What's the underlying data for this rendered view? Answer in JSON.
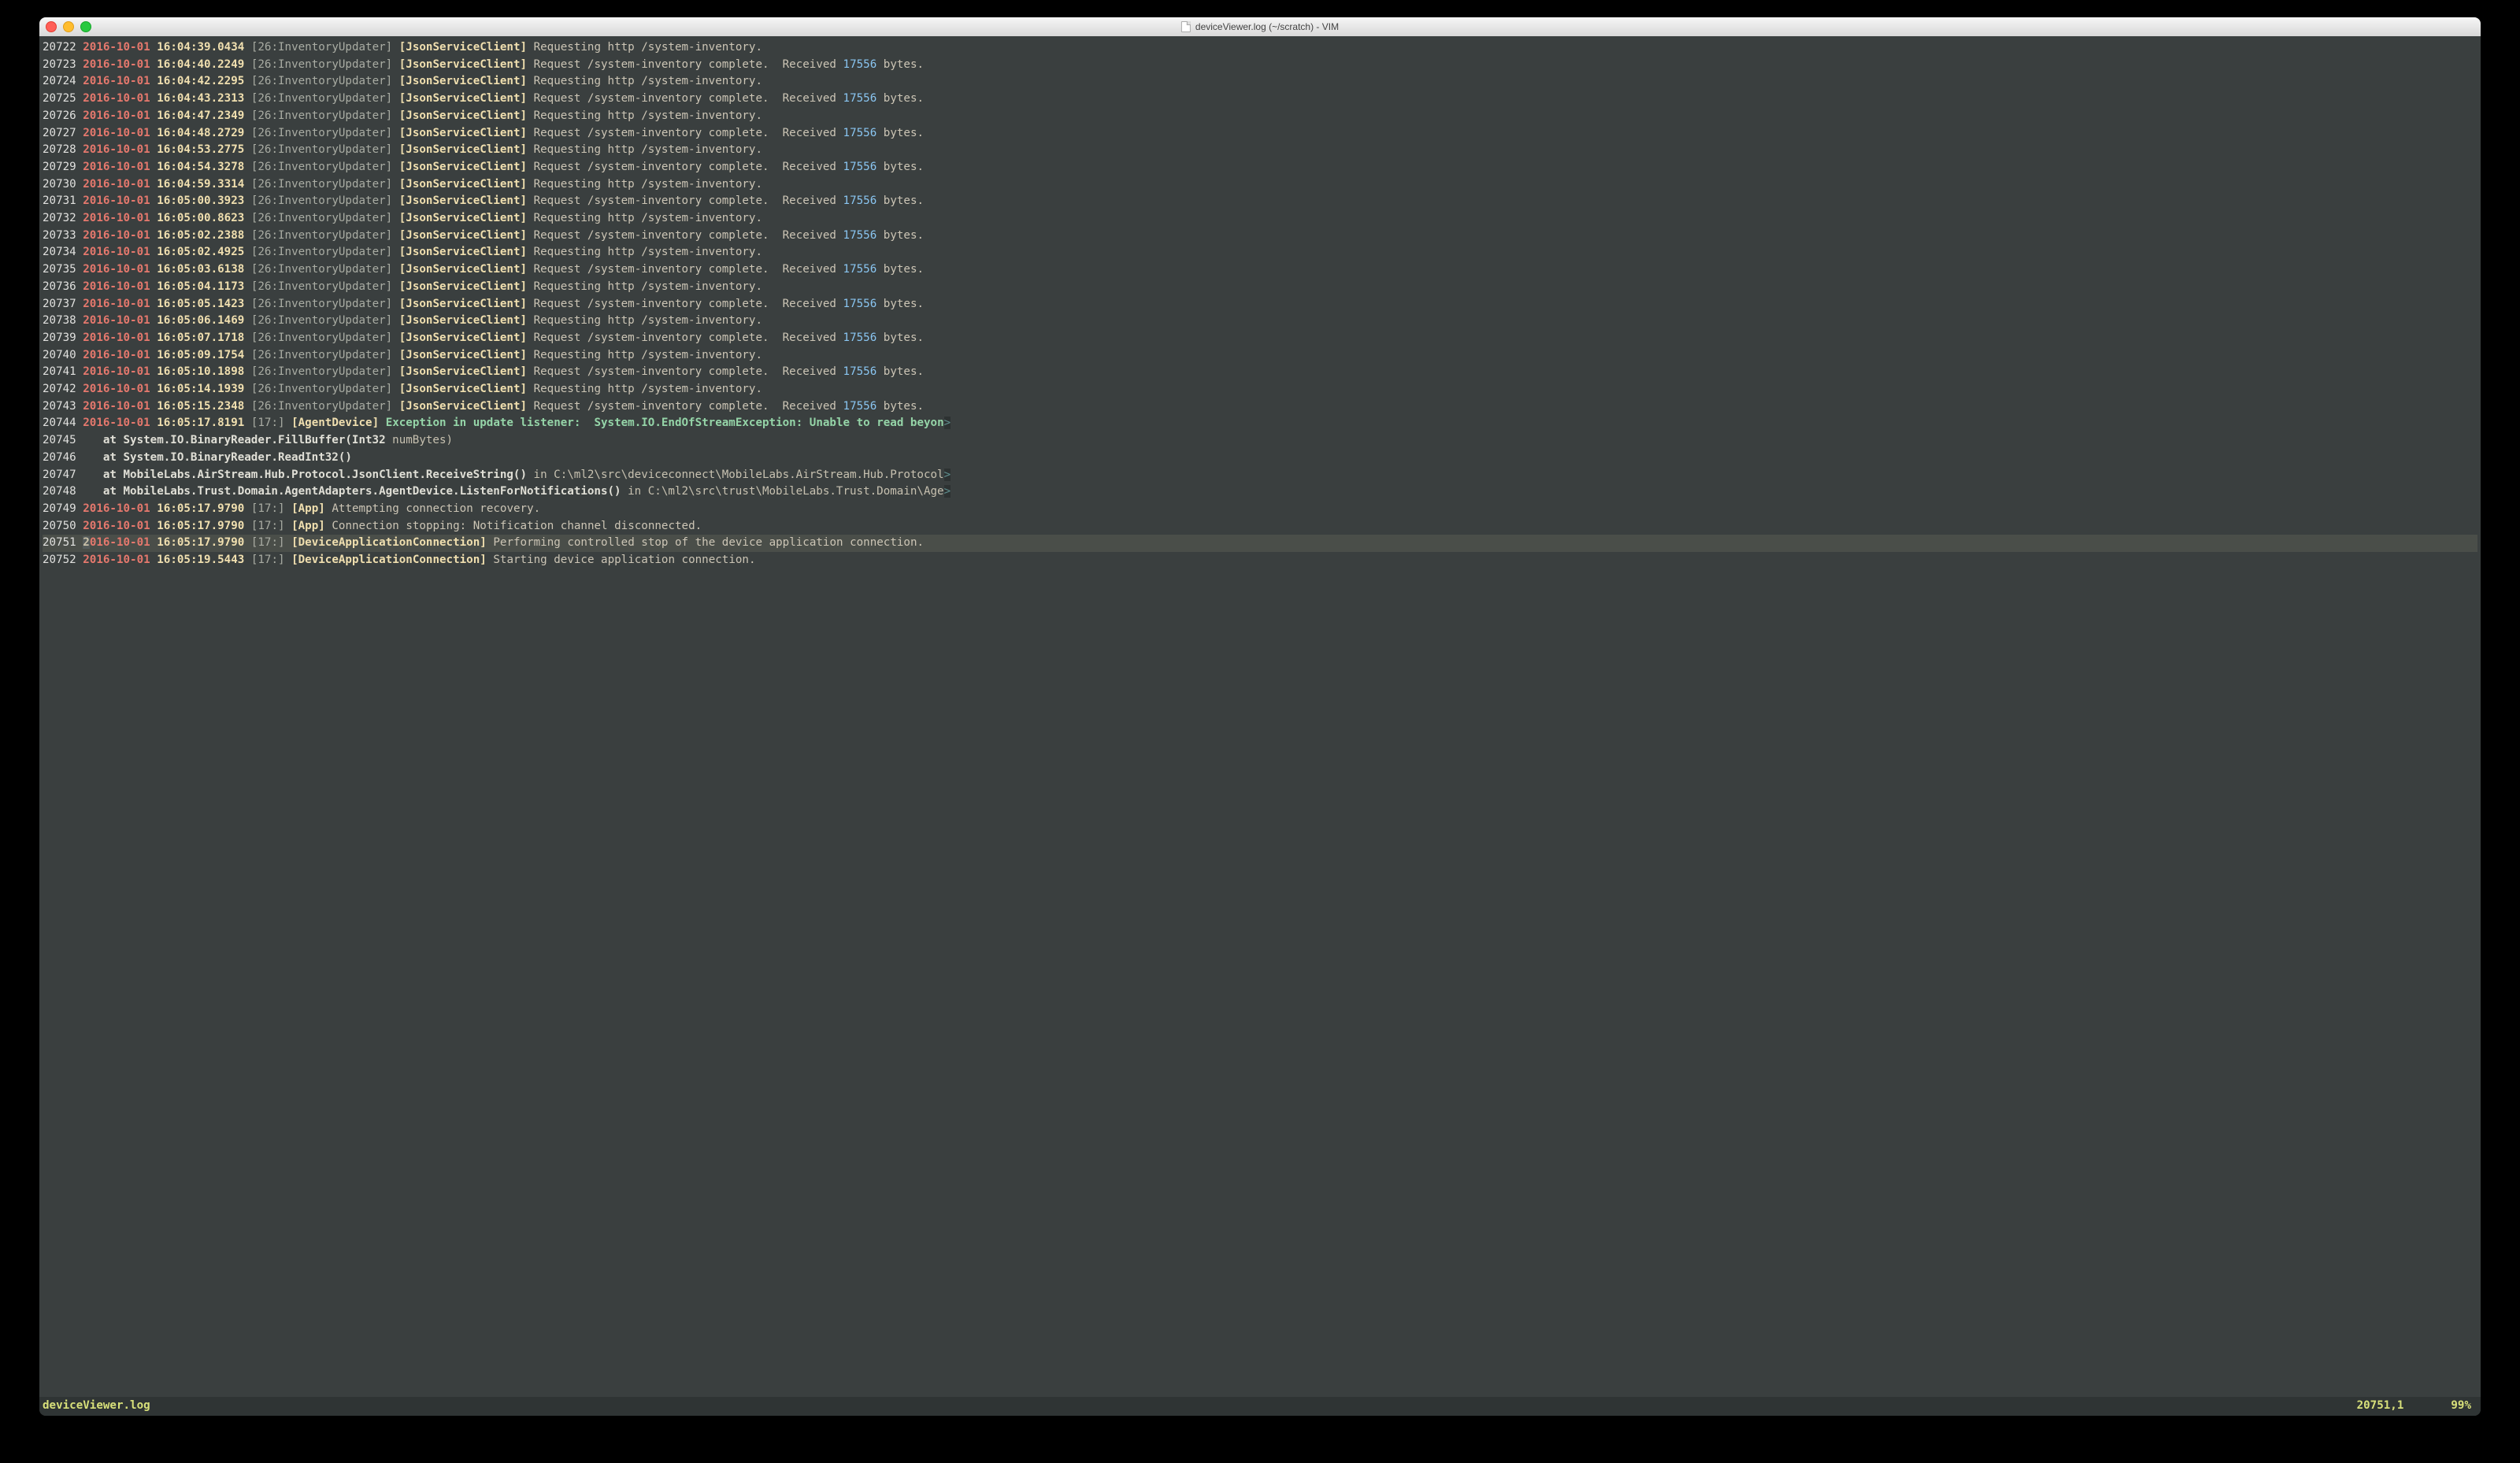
{
  "window": {
    "title": "deviceViewer.log (~/scratch) - VIM"
  },
  "status": {
    "filename": "deviceViewer.log",
    "position": "20751,1",
    "percent": "99%"
  },
  "cursor_row_index": 29,
  "lines": [
    {
      "n": "20722",
      "d": "2016-10-01",
      "t": "16:04:39.0434",
      "thr": "[26:InventoryUpdater]",
      "svc": "[JsonServiceClient]",
      "m1": "Requesting http /system-inventory.",
      "rx": null
    },
    {
      "n": "20723",
      "d": "2016-10-01",
      "t": "16:04:40.2249",
      "thr": "[26:InventoryUpdater]",
      "svc": "[JsonServiceClient]",
      "m1": "Request /system-inventory complete.",
      "rx": "17556"
    },
    {
      "n": "20724",
      "d": "2016-10-01",
      "t": "16:04:42.2295",
      "thr": "[26:InventoryUpdater]",
      "svc": "[JsonServiceClient]",
      "m1": "Requesting http /system-inventory.",
      "rx": null
    },
    {
      "n": "20725",
      "d": "2016-10-01",
      "t": "16:04:43.2313",
      "thr": "[26:InventoryUpdater]",
      "svc": "[JsonServiceClient]",
      "m1": "Request /system-inventory complete.",
      "rx": "17556"
    },
    {
      "n": "20726",
      "d": "2016-10-01",
      "t": "16:04:47.2349",
      "thr": "[26:InventoryUpdater]",
      "svc": "[JsonServiceClient]",
      "m1": "Requesting http /system-inventory.",
      "rx": null
    },
    {
      "n": "20727",
      "d": "2016-10-01",
      "t": "16:04:48.2729",
      "thr": "[26:InventoryUpdater]",
      "svc": "[JsonServiceClient]",
      "m1": "Request /system-inventory complete.",
      "rx": "17556"
    },
    {
      "n": "20728",
      "d": "2016-10-01",
      "t": "16:04:53.2775",
      "thr": "[26:InventoryUpdater]",
      "svc": "[JsonServiceClient]",
      "m1": "Requesting http /system-inventory.",
      "rx": null
    },
    {
      "n": "20729",
      "d": "2016-10-01",
      "t": "16:04:54.3278",
      "thr": "[26:InventoryUpdater]",
      "svc": "[JsonServiceClient]",
      "m1": "Request /system-inventory complete.",
      "rx": "17556"
    },
    {
      "n": "20730",
      "d": "2016-10-01",
      "t": "16:04:59.3314",
      "thr": "[26:InventoryUpdater]",
      "svc": "[JsonServiceClient]",
      "m1": "Requesting http /system-inventory.",
      "rx": null
    },
    {
      "n": "20731",
      "d": "2016-10-01",
      "t": "16:05:00.3923",
      "thr": "[26:InventoryUpdater]",
      "svc": "[JsonServiceClient]",
      "m1": "Request /system-inventory complete.",
      "rx": "17556"
    },
    {
      "n": "20732",
      "d": "2016-10-01",
      "t": "16:05:00.8623",
      "thr": "[26:InventoryUpdater]",
      "svc": "[JsonServiceClient]",
      "m1": "Requesting http /system-inventory.",
      "rx": null
    },
    {
      "n": "20733",
      "d": "2016-10-01",
      "t": "16:05:02.2388",
      "thr": "[26:InventoryUpdater]",
      "svc": "[JsonServiceClient]",
      "m1": "Request /system-inventory complete.",
      "rx": "17556"
    },
    {
      "n": "20734",
      "d": "2016-10-01",
      "t": "16:05:02.4925",
      "thr": "[26:InventoryUpdater]",
      "svc": "[JsonServiceClient]",
      "m1": "Requesting http /system-inventory.",
      "rx": null
    },
    {
      "n": "20735",
      "d": "2016-10-01",
      "t": "16:05:03.6138",
      "thr": "[26:InventoryUpdater]",
      "svc": "[JsonServiceClient]",
      "m1": "Request /system-inventory complete.",
      "rx": "17556"
    },
    {
      "n": "20736",
      "d": "2016-10-01",
      "t": "16:05:04.1173",
      "thr": "[26:InventoryUpdater]",
      "svc": "[JsonServiceClient]",
      "m1": "Requesting http /system-inventory.",
      "rx": null
    },
    {
      "n": "20737",
      "d": "2016-10-01",
      "t": "16:05:05.1423",
      "thr": "[26:InventoryUpdater]",
      "svc": "[JsonServiceClient]",
      "m1": "Request /system-inventory complete.",
      "rx": "17556"
    },
    {
      "n": "20738",
      "d": "2016-10-01",
      "t": "16:05:06.1469",
      "thr": "[26:InventoryUpdater]",
      "svc": "[JsonServiceClient]",
      "m1": "Requesting http /system-inventory.",
      "rx": null
    },
    {
      "n": "20739",
      "d": "2016-10-01",
      "t": "16:05:07.1718",
      "thr": "[26:InventoryUpdater]",
      "svc": "[JsonServiceClient]",
      "m1": "Request /system-inventory complete.",
      "rx": "17556"
    },
    {
      "n": "20740",
      "d": "2016-10-01",
      "t": "16:05:09.1754",
      "thr": "[26:InventoryUpdater]",
      "svc": "[JsonServiceClient]",
      "m1": "Requesting http /system-inventory.",
      "rx": null
    },
    {
      "n": "20741",
      "d": "2016-10-01",
      "t": "16:05:10.1898",
      "thr": "[26:InventoryUpdater]",
      "svc": "[JsonServiceClient]",
      "m1": "Request /system-inventory complete.",
      "rx": "17556"
    },
    {
      "n": "20742",
      "d": "2016-10-01",
      "t": "16:05:14.1939",
      "thr": "[26:InventoryUpdater]",
      "svc": "[JsonServiceClient]",
      "m1": "Requesting http /system-inventory.",
      "rx": null
    },
    {
      "n": "20743",
      "d": "2016-10-01",
      "t": "16:05:15.2348",
      "thr": "[26:InventoryUpdater]",
      "svc": "[JsonServiceClient]",
      "m1": "Request /system-inventory complete.",
      "rx": "17556"
    },
    {
      "kind": "exc",
      "n": "20744",
      "d": "2016-10-01",
      "t": "16:05:17.8191",
      "thr": "[17:]",
      "svc": "[AgentDevice]",
      "m1": "Exception in update listener:  System.IO.EndOfStreamException: Unable to read beyon",
      "ext": ">"
    },
    {
      "kind": "trace",
      "n": "20745",
      "lead": "   at ",
      "bold": "System.IO.BinaryReader.FillBuffer(Int32",
      "tail": " numBytes)"
    },
    {
      "kind": "trace",
      "n": "20746",
      "lead": "   at ",
      "bold": "System.IO.BinaryReader.ReadInt32()",
      "tail": ""
    },
    {
      "kind": "trace",
      "n": "20747",
      "lead": "   at ",
      "bold": "MobileLabs.AirStream.Hub.Protocol.JsonClient.ReceiveString()",
      "tail": " in C:\\ml2\\src\\deviceconnect\\MobileLabs.AirStream.Hub.Protocol",
      "ext": ">"
    },
    {
      "kind": "trace",
      "n": "20748",
      "lead": "   at ",
      "bold": "MobileLabs.Trust.Domain.AgentAdapters.AgentDevice.ListenForNotifications()",
      "tail": " in C:\\ml2\\src\\trust\\MobileLabs.Trust.Domain\\Age",
      "ext": ">"
    },
    {
      "n": "20749",
      "d": "2016-10-01",
      "t": "16:05:17.9790",
      "thr": "[17:]",
      "svc": "[App]",
      "m1": "Attempting connection recovery.",
      "rx": null
    },
    {
      "n": "20750",
      "d": "2016-10-01",
      "t": "16:05:17.9790",
      "thr": "[17:]",
      "svc": "[App]",
      "m1": "Connection stopping: Notification channel disconnected.",
      "rx": null
    },
    {
      "n": "20751",
      "d": "2016-10-01",
      "t": "16:05:17.9790",
      "thr": "[17:]",
      "svc": "[DeviceApplicationConnection]",
      "m1": "Performing controlled stop of the device application connection.",
      "rx": null,
      "cursor": true
    },
    {
      "n": "20752",
      "d": "2016-10-01",
      "t": "16:05:19.5443",
      "thr": "[17:]",
      "svc": "[DeviceApplicationConnection]",
      "m1": "Starting device application connection.",
      "rx": null
    }
  ],
  "labels": {
    "received": "Received",
    "bytes": "bytes."
  }
}
